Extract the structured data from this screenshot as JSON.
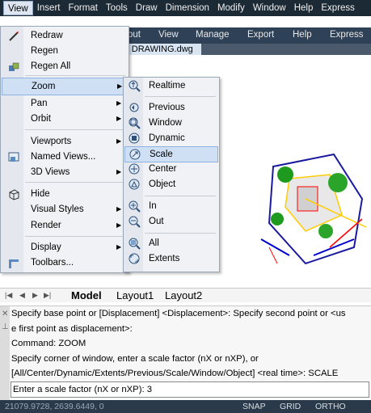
{
  "menubar": {
    "items": [
      "View",
      "Insert",
      "Format",
      "Tools",
      "Draw",
      "Dimension",
      "Modify",
      "Window",
      "Help",
      "Express"
    ]
  },
  "ribbon": {
    "tabs": [
      "out",
      "View",
      "Manage",
      "Export",
      "Help",
      "Express"
    ],
    "document_tab": "L DRAWING.dwg"
  },
  "view_menu": {
    "items": [
      {
        "label": "Redraw",
        "icon": "redraw-icon"
      },
      {
        "label": "Regen",
        "icon": ""
      },
      {
        "label": "Regen All",
        "icon": "regen-all-icon"
      },
      {
        "label": "Zoom",
        "icon": ""
      },
      {
        "label": "Pan",
        "icon": ""
      },
      {
        "label": "Orbit",
        "icon": ""
      },
      {
        "label": "Viewports",
        "icon": ""
      },
      {
        "label": "Named Views...",
        "icon": "named-views-icon"
      },
      {
        "label": "3D Views",
        "icon": ""
      },
      {
        "label": "Hide",
        "icon": "hide-icon"
      },
      {
        "label": "Visual Styles",
        "icon": ""
      },
      {
        "label": "Render",
        "icon": ""
      },
      {
        "label": "Display",
        "icon": ""
      },
      {
        "label": "Toolbars...",
        "icon": "toolbars-icon"
      }
    ]
  },
  "zoom_submenu": {
    "items": [
      "Realtime",
      "Previous",
      "Window",
      "Dynamic",
      "Scale",
      "Center",
      "Object",
      "In",
      "Out",
      "All",
      "Extents"
    ]
  },
  "layout_tabs": [
    "Model",
    "Layout1",
    "Layout2"
  ],
  "command": {
    "history": [
      "Specify base point or [Displacement] <Displacement>: Specify second point or <us",
      "e first point as displacement>:",
      "Command: ZOOM",
      "Specify corner of window, enter a scale factor (nX or nXP), or",
      "[All/Center/Dynamic/Extents/Previous/Scale/Window/Object] <real time>: SCALE"
    ],
    "input": "Enter a scale factor (nX or nXP): 3"
  },
  "status": {
    "coords": "21079.9728, 2639.6449, 0",
    "buttons": [
      "SNAP",
      "GRID",
      "ORTHO"
    ]
  },
  "colors": {
    "menubar_bg": "#1c2a36",
    "highlight": "#cfe0f5",
    "status_bg": "#2b3a4a"
  }
}
